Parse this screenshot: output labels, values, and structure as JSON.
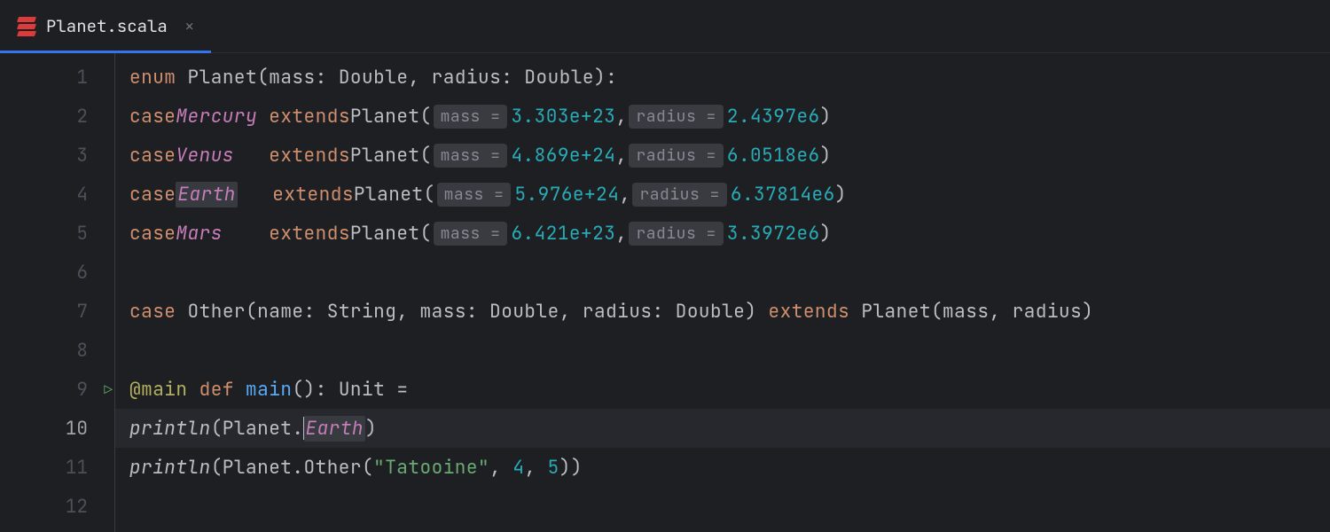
{
  "tab": {
    "filename": "Planet.scala",
    "close": "✕"
  },
  "gutter": {
    "line_count": 12,
    "current_line": 10,
    "run_gutter_line": 9
  },
  "code": {
    "l1": {
      "kw_enum": "enum",
      "name": "Planet",
      "open": "(mass: Double, radius: Double):"
    },
    "cases": [
      {
        "kw": "case",
        "name": "Mercury",
        "pad": " ",
        "ext": "extends",
        "cls": "Planet(",
        "h1": "mass =",
        "mass": "3.303e+23",
        "c": ",",
        "h2": "radius =",
        "radius": "2.4397e6",
        "close": ")"
      },
      {
        "kw": "case",
        "name": "Venus",
        "pad": "   ",
        "ext": "extends",
        "cls": "Planet(",
        "h1": "mass =",
        "mass": "4.869e+24",
        "c": ",",
        "h2": "radius =",
        "radius": "6.0518e6",
        "close": ")"
      },
      {
        "kw": "case",
        "name": "Earth",
        "pad": "   ",
        "ext": "extends",
        "cls": "Planet(",
        "h1": "mass =",
        "mass": "5.976e+24",
        "c": ",",
        "h2": "radius =",
        "radius": "6.37814e6",
        "close": ")",
        "highlight": true
      },
      {
        "kw": "case",
        "name": "Mars",
        "pad": "    ",
        "ext": "extends",
        "cls": "Planet(",
        "h1": "mass =",
        "mass": "6.421e+23",
        "c": ",",
        "h2": "radius =",
        "radius": "3.3972e6",
        "close": ")"
      }
    ],
    "l7": {
      "kw_case": "case",
      "sig": "Other(name: String, mass: Double, radius: Double)",
      "ext": "extends",
      "rest": "Planet(mass, radius)"
    },
    "l9": {
      "anno": "@main",
      "def": "def",
      "fn": "main",
      "sig": "(): Unit ="
    },
    "l10": {
      "fn": "println",
      "open": "(Planet.",
      "ref": "Earth",
      "close": ")"
    },
    "l11": {
      "fn": "println",
      "open": "(Planet.Other(",
      "str": "\"Tatooine\"",
      "c1": ", ",
      "n1": "4",
      "c2": ", ",
      "n2": "5",
      "close": "))"
    }
  }
}
